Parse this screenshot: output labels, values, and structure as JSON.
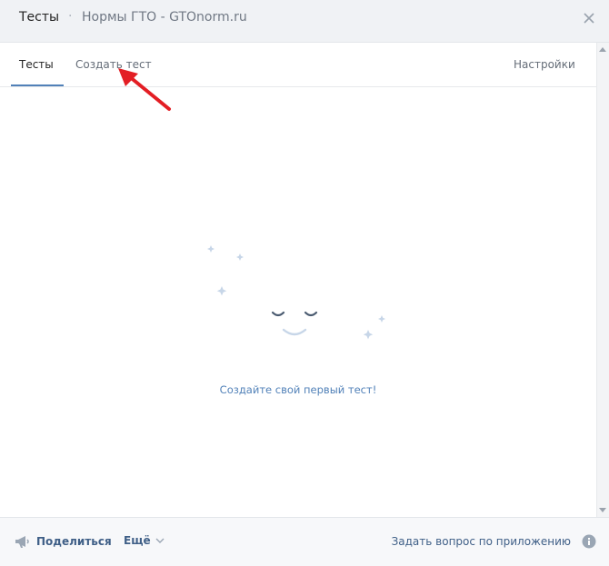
{
  "header": {
    "title": "Тесты",
    "separator": "·",
    "subtitle": "Нормы ГТО - GTOnorm.ru",
    "close_icon": "close-icon"
  },
  "tabs": [
    {
      "label": "Тесты",
      "active": true
    },
    {
      "label": "Создать тест",
      "active": false
    }
  ],
  "settings_label": "Настройки",
  "empty_state": {
    "message": "Создайте свой первый тест!",
    "icon": "sleeping-face-icon"
  },
  "footer": {
    "share_label": "Поделиться",
    "more_label": "Ещё",
    "ask_label": "Задать вопрос по приложению"
  },
  "colors": {
    "accent": "#5181b8",
    "link": "#3f5f87",
    "annotation_arrow": "#e31e24"
  }
}
